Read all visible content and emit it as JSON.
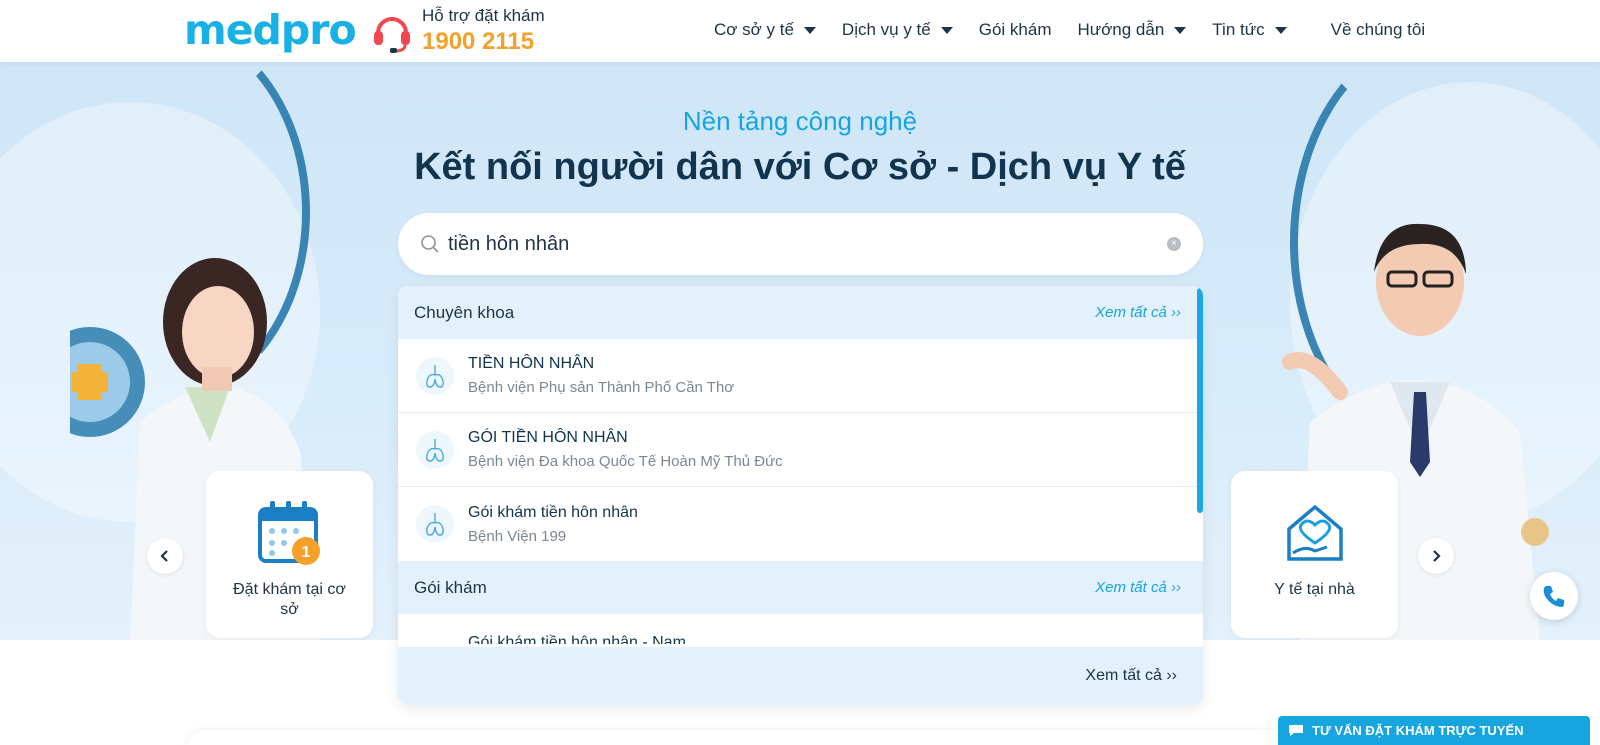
{
  "header": {
    "logo": "medpro",
    "support_label": "Hỗ trợ đặt khám",
    "support_phone": "1900 2115",
    "nav": [
      {
        "label": "Cơ sở y tế",
        "dropdown": true
      },
      {
        "label": "Dịch vụ y tế",
        "dropdown": true
      },
      {
        "label": "Gói khám",
        "dropdown": false
      },
      {
        "label": "Hướng dẫn",
        "dropdown": true
      },
      {
        "label": "Tin tức",
        "dropdown": true
      },
      {
        "label": "Về chúng tôi",
        "dropdown": false
      }
    ]
  },
  "hero": {
    "tagline": "Nền tảng công nghệ",
    "headline": "Kết nối người dân với Cơ sở - Dịch vụ Y tế"
  },
  "search": {
    "value": "tiền hôn nhân"
  },
  "dropdown": {
    "sections": [
      {
        "title": "Chuyên khoa",
        "more": "Xem tất cả",
        "items": [
          {
            "name": "TIỀN HÔN NHÂN",
            "place": "Bệnh viện Phụ sản Thành Phố Cần Thơ"
          },
          {
            "name": "GÓI TIỀN HÔN NHÂN",
            "place": "Bệnh viện Đa khoa Quốc Tế Hoàn Mỹ Thủ Đức"
          },
          {
            "name": "Gói khám tiền hôn nhân",
            "place": "Bệnh Viện 199"
          }
        ]
      },
      {
        "title": "Gói khám",
        "more": "Xem tất cả",
        "items": [
          {
            "name": "Gói khám tiền hôn nhân - Nam"
          }
        ]
      }
    ],
    "footer_more": "Xem tất cả"
  },
  "cards": {
    "left_label": "Đặt khám tại cơ sở",
    "left_badge": "1",
    "right_label": "Y tế tại nhà"
  },
  "chat": {
    "label": "TƯ VẤN ĐẶT KHÁM TRỰC TUYẾN"
  },
  "colors": {
    "brand": "#17b1e6",
    "accent_orange": "#f4a02b",
    "headline": "#12344f",
    "section_bg": "#e3f1fc"
  }
}
